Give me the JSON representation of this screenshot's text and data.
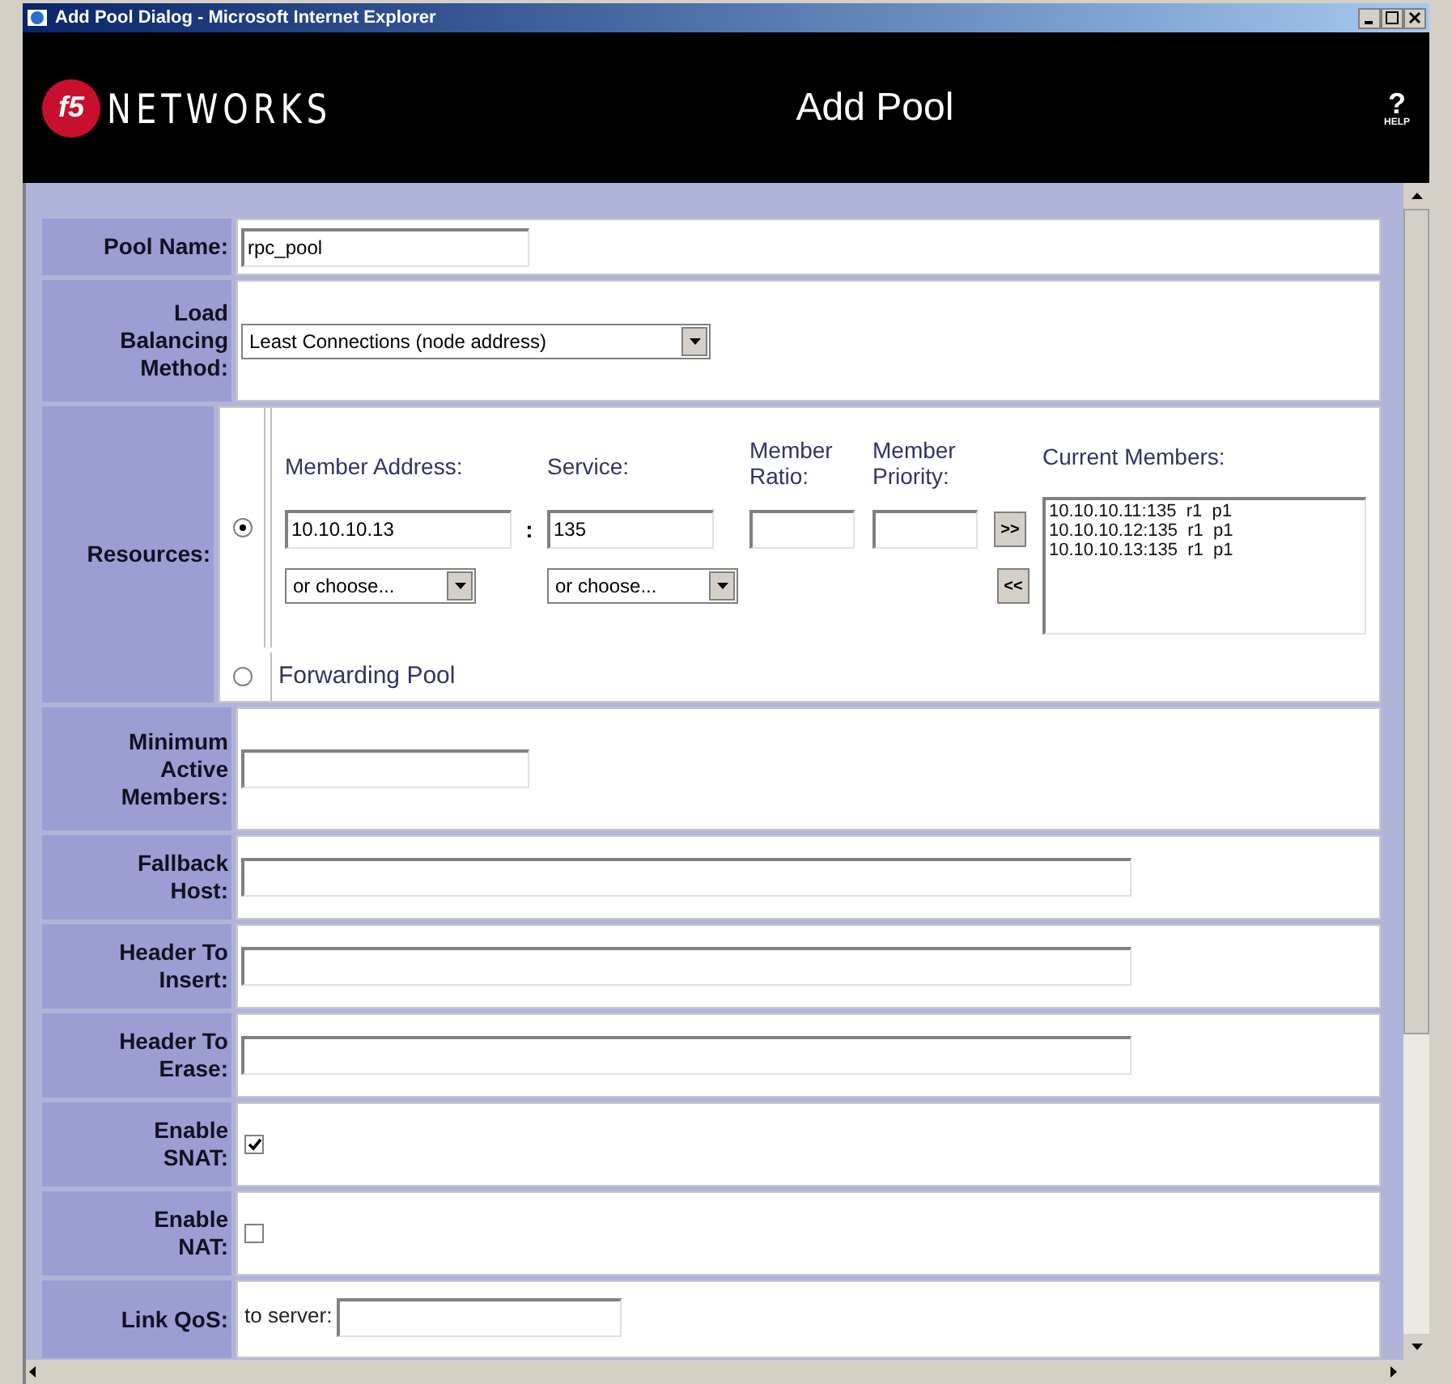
{
  "window": {
    "title": "Add Pool Dialog - Microsoft Internet Explorer"
  },
  "header": {
    "logo_mark": "f5",
    "logo_text": "NETWORKS",
    "title": "Add Pool",
    "help_mark": "?",
    "help_label": "HELP"
  },
  "rows": [
    {
      "kind": "short",
      "label": "Pool Name:",
      "value": "rpc_pool"
    },
    {
      "kind": "select",
      "label": "Load\nBalancing\nMethod:",
      "value": "Least Connections (node address)"
    },
    {
      "kind": "resources",
      "label": "Resources:"
    },
    {
      "kind": "short",
      "label": "Minimum\nActive\nMembers:"
    },
    {
      "kind": "long",
      "label": "Fallback\nHost:"
    },
    {
      "kind": "long",
      "label": "Header To\nInsert:"
    },
    {
      "kind": "long",
      "label": "Header To\nErase:"
    },
    {
      "kind": "checkbox",
      "label": "Enable\nSNAT:",
      "checked": true
    },
    {
      "kind": "checkbox",
      "label": "Enable\nNAT:",
      "checked": false
    },
    {
      "kind": "qos",
      "label": "Link QoS:",
      "field_label": "to server:"
    }
  ],
  "resources": {
    "member_option": {
      "selected": true
    },
    "headers": {
      "address": "Member Address:",
      "service": "Service:",
      "ratio": "Member Ratio:",
      "priority": "Member Priority:",
      "current": "Current Members:"
    },
    "address": "10.10.10.13",
    "separator": ":",
    "service": "135",
    "address_choose": "or choose...",
    "service_choose": "or choose...",
    "add_button": ">>",
    "remove_button": "<<",
    "current_members": [
      "10.10.10.11:135  r1  p1",
      "10.10.10.12:135  r1  p1",
      "10.10.10.13:135  r1  p1"
    ],
    "forwarding_option": {
      "label": "Forwarding Pool",
      "selected": false
    }
  }
}
